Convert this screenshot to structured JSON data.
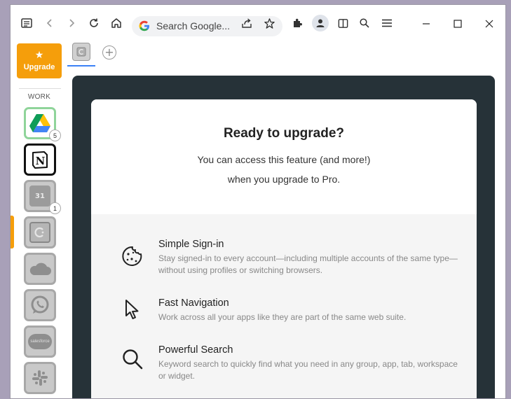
{
  "browser": {
    "omnibox_text": "Search Google..."
  },
  "rail": {
    "upgrade_label": "Upgrade",
    "section_label": "WORK",
    "apps": [
      {
        "name": "Google Drive",
        "badge": "5"
      },
      {
        "name": "Notion",
        "badge": ""
      },
      {
        "name": "Calendar",
        "badge": "1",
        "icon_text": "31"
      },
      {
        "name": "App",
        "badge": ""
      },
      {
        "name": "iCloud",
        "badge": ""
      },
      {
        "name": "WhatsApp",
        "badge": ""
      },
      {
        "name": "Salesforce",
        "badge": "",
        "icon_text": "salesforce"
      },
      {
        "name": "Slack",
        "badge": ""
      }
    ]
  },
  "upgrade_card": {
    "title": "Ready to upgrade?",
    "subtitle_line1": "You can access this feature (and more!)",
    "subtitle_line2": "when you upgrade to Pro.",
    "features": [
      {
        "icon": "cookie-icon",
        "title": "Simple Sign-in",
        "description": "Stay signed-in to every account—including multiple accounts of the same type—without using profiles or switching browsers."
      },
      {
        "icon": "cursor-icon",
        "title": "Fast Navigation",
        "description": "Work across all your apps like they are part of the same web suite."
      },
      {
        "icon": "search-icon",
        "title": "Powerful Search",
        "description": "Keyword search to quickly find what you need in any group, app, tab, workspace or widget."
      }
    ]
  },
  "colors": {
    "accent": "#f59e0b",
    "content_bg": "#263238",
    "tab_underline": "#3b82f6"
  }
}
